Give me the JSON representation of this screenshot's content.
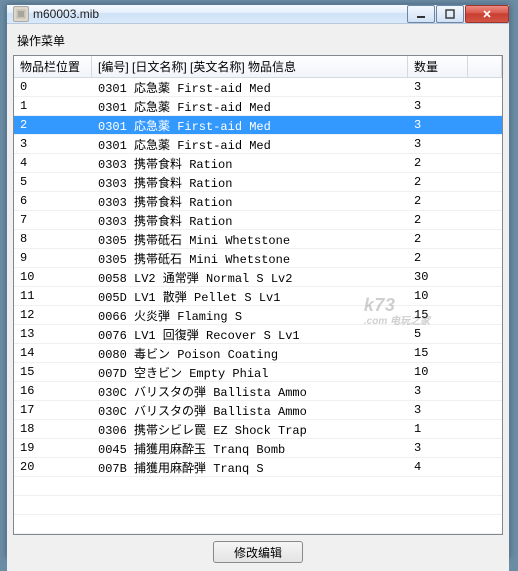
{
  "window": {
    "title": "m60003.mib"
  },
  "menu": {
    "label": "操作菜单"
  },
  "columns": {
    "position": "物品栏位置",
    "item": "[编号] [日文名称] [英文名称]    物品信息",
    "quantity": "数量"
  },
  "rows": [
    {
      "pos": "0",
      "item": "0301 応急薬 First-aid Med",
      "qty": "3",
      "selected": false
    },
    {
      "pos": "1",
      "item": "0301 応急薬 First-aid Med",
      "qty": "3",
      "selected": false
    },
    {
      "pos": "2",
      "item": "0301 応急薬 First-aid Med",
      "qty": "3",
      "selected": true
    },
    {
      "pos": "3",
      "item": "0301 応急薬 First-aid Med",
      "qty": "3",
      "selected": false
    },
    {
      "pos": "4",
      "item": "0303 携帯食料 Ration",
      "qty": "2",
      "selected": false
    },
    {
      "pos": "5",
      "item": "0303 携帯食料 Ration",
      "qty": "2",
      "selected": false
    },
    {
      "pos": "6",
      "item": "0303 携帯食料 Ration",
      "qty": "2",
      "selected": false
    },
    {
      "pos": "7",
      "item": "0303 携帯食料 Ration",
      "qty": "2",
      "selected": false
    },
    {
      "pos": "8",
      "item": "0305 携帯砥石 Mini Whetstone",
      "qty": "2",
      "selected": false
    },
    {
      "pos": "9",
      "item": "0305 携帯砥石 Mini Whetstone",
      "qty": "2",
      "selected": false
    },
    {
      "pos": "10",
      "item": "0058 LV2 通常弾 Normal S Lv2",
      "qty": "30",
      "selected": false
    },
    {
      "pos": "11",
      "item": "005D LV1 散弾 Pellet S Lv1",
      "qty": "10",
      "selected": false
    },
    {
      "pos": "12",
      "item": "0066 火炎弾 Flaming S",
      "qty": "15",
      "selected": false
    },
    {
      "pos": "13",
      "item": "0076 LV1 回復弾 Recover S Lv1",
      "qty": "5",
      "selected": false
    },
    {
      "pos": "14",
      "item": "0080 毒ビン Poison Coating",
      "qty": "15",
      "selected": false
    },
    {
      "pos": "15",
      "item": "007D 空きビン Empty Phial",
      "qty": "10",
      "selected": false
    },
    {
      "pos": "16",
      "item": "030C バリスタの弾 Ballista Ammo",
      "qty": "3",
      "selected": false
    },
    {
      "pos": "17",
      "item": "030C バリスタの弾 Ballista Ammo",
      "qty": "3",
      "selected": false
    },
    {
      "pos": "18",
      "item": "0306 携帯シビレ罠 EZ Shock Trap",
      "qty": "1",
      "selected": false
    },
    {
      "pos": "19",
      "item": "0045 捕獲用麻酔玉 Tranq Bomb",
      "qty": "3",
      "selected": false
    },
    {
      "pos": "20",
      "item": "007B 捕獲用麻酔弾 Tranq S",
      "qty": "4",
      "selected": false
    }
  ],
  "buttons": {
    "edit": "修改编辑"
  },
  "watermark": {
    "main": "k73",
    "sub": ".com 电玩之家"
  }
}
